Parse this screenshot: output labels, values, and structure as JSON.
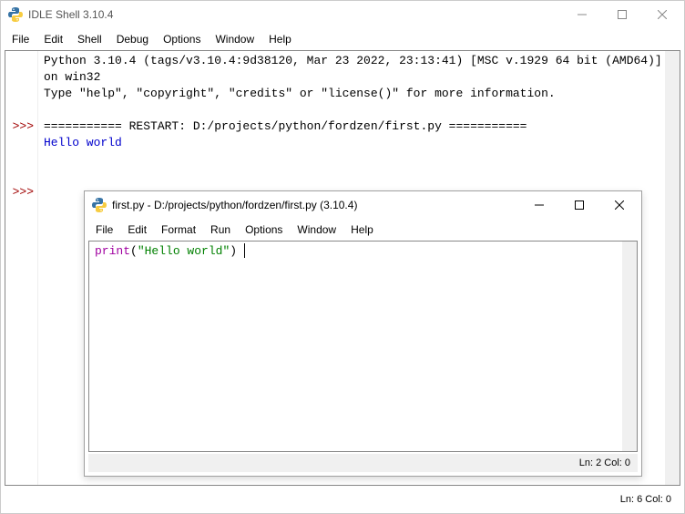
{
  "shell": {
    "title": "IDLE Shell 3.10.4",
    "menu": [
      "File",
      "Edit",
      "Shell",
      "Debug",
      "Options",
      "Window",
      "Help"
    ],
    "banner_l1": "Python 3.10.4 (tags/v3.10.4:9d38120, Mar 23 2022, 23:13:41) [MSC v.1929 64 bit (AMD64)] on win32",
    "banner_l2": "Type \"help\", \"copyright\", \"credits\" or \"license()\" for more information.",
    "restart_line": "=========== RESTART: D:/projects/python/fordzen/first.py ===========",
    "output": "Hello world",
    "prompt": ">>>",
    "status": "Ln: 6   Col: 0"
  },
  "editor": {
    "title": "first.py - D:/projects/python/fordzen/first.py (3.10.4)",
    "menu": [
      "File",
      "Edit",
      "Format",
      "Run",
      "Options",
      "Window",
      "Help"
    ],
    "code_fn": "print",
    "code_open": "(",
    "code_str": "\"Hello world\"",
    "code_close": ")",
    "status": "Ln: 2   Col: 0"
  }
}
